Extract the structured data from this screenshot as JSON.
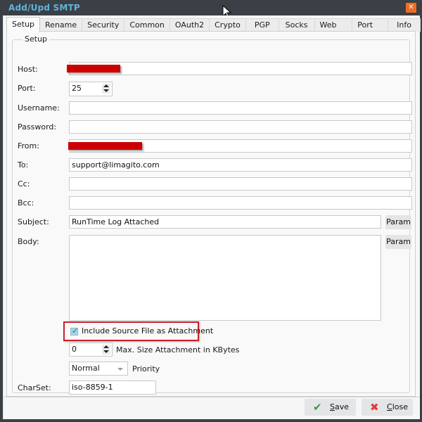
{
  "window": {
    "title": "Add/Upd SMTP",
    "close_icon": "close-x-icon"
  },
  "tabs": [
    {
      "label": "Setup",
      "active": true
    },
    {
      "label": "Rename",
      "active": false
    },
    {
      "label": "Security",
      "active": false
    },
    {
      "label": "Common",
      "active": false
    },
    {
      "label": "OAuth2",
      "active": false
    },
    {
      "label": "Crypto",
      "active": false
    },
    {
      "label": "PGP",
      "active": false
    },
    {
      "label": "Socks",
      "active": false
    },
    {
      "label": "Web Tunnel",
      "active": false
    },
    {
      "label": "Port Knock",
      "active": false
    },
    {
      "label": "Info",
      "active": false
    }
  ],
  "setup": {
    "group_label": "Setup",
    "host": {
      "label": "Host:",
      "value": "",
      "redacted": true
    },
    "port": {
      "label": "Port:",
      "value": "25"
    },
    "username": {
      "label": "Username:",
      "value": ""
    },
    "password": {
      "label": "Password:",
      "value": ""
    },
    "from": {
      "label": "From:",
      "value": "",
      "redacted": true
    },
    "to": {
      "label": "To:",
      "value": "support@limagito.com"
    },
    "cc": {
      "label": "Cc:",
      "value": ""
    },
    "bcc": {
      "label": "Bcc:",
      "value": ""
    },
    "subject": {
      "label": "Subject:",
      "value": "RunTime Log Attached",
      "param_label": "Param"
    },
    "body": {
      "label": "Body:",
      "value": "",
      "param_label": "Param"
    },
    "include_source": {
      "label": "Include Source File as Attachment",
      "checked": true
    },
    "max_size": {
      "value": "0",
      "label": "Max. Size Attachment in KBytes"
    },
    "priority": {
      "value": "Normal",
      "label": "Priority"
    },
    "charset": {
      "label": "CharSet:",
      "value": "iso-8859-1"
    }
  },
  "footer": {
    "save_label": "Save",
    "save_mnemonic": "S",
    "save_rest": "ave",
    "close_label": "Close",
    "close_mnemonic": "C",
    "close_rest": "lose",
    "save_icon": "✔",
    "close_icon": "✖"
  },
  "colors": {
    "title": "#5fb4dc",
    "close_button": "#f26a22",
    "redaction": "#cc0000",
    "highlight_border": "#c8202a",
    "save_check": "#3a9b3a",
    "close_x": "#e8373c"
  }
}
